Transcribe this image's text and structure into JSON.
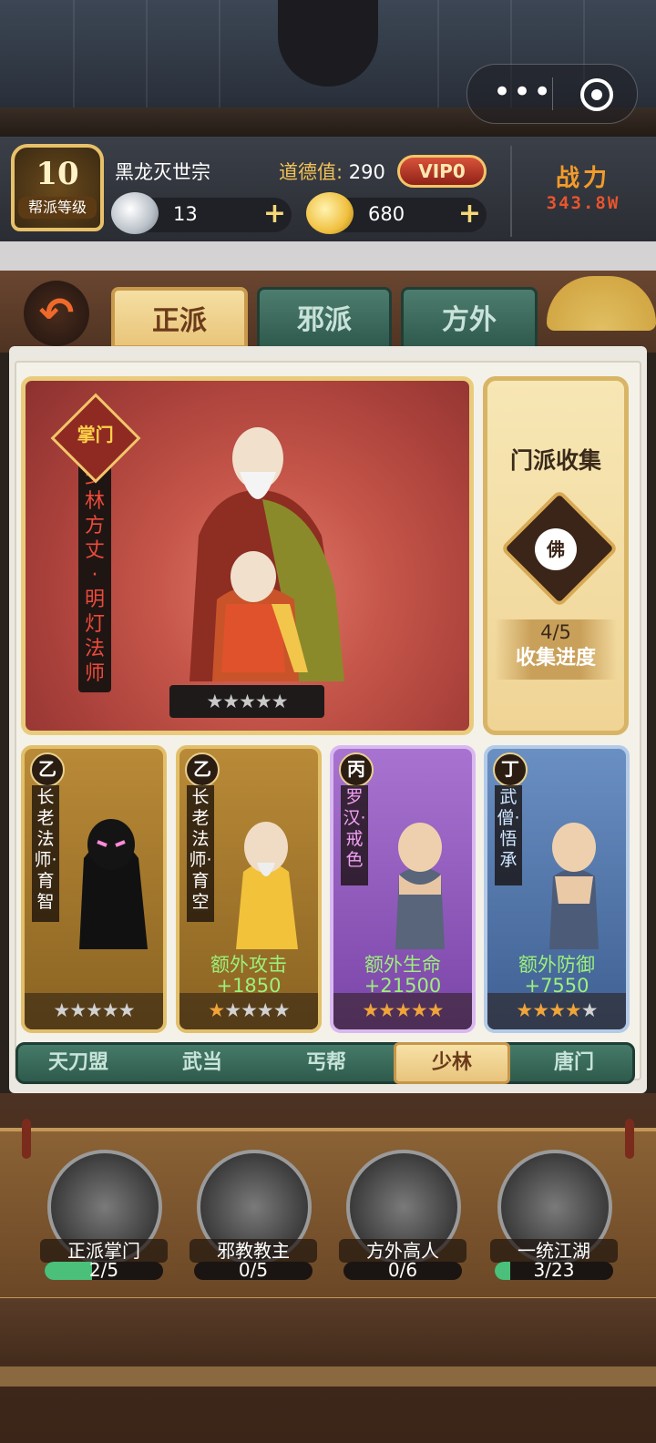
{
  "capsule": {
    "more_icon": "more-dots-icon",
    "close_icon": "target-circle-icon"
  },
  "player": {
    "sect_level": "10",
    "sect_level_label": "帮派等级",
    "name": "黑龙灭世宗",
    "morality_label": "道德值:",
    "morality_value": "290",
    "vip": "VIP0",
    "silver": "13",
    "gold": "680",
    "power_label": "战力",
    "power_value": "343.8W"
  },
  "tabs": [
    {
      "label": "正派",
      "active": true
    },
    {
      "label": "邪派",
      "active": false
    },
    {
      "label": "方外",
      "active": false
    }
  ],
  "hero": {
    "badge": "掌门",
    "name": "少林方丈·明灯法师",
    "stars": "★★★★★"
  },
  "collection": {
    "title": "门派收集",
    "emblem": "佛",
    "progress": "4/5",
    "progress_label": "收集进度"
  },
  "members": [
    {
      "grade": "乙",
      "name": "长老法师·育智",
      "bonus_label": "",
      "bonus_value": "",
      "stars_on": "",
      "stars_off": "★★★★★"
    },
    {
      "grade": "乙",
      "name": "长老法师·育空",
      "bonus_label": "额外攻击",
      "bonus_value": "+1850",
      "stars_on": "★",
      "stars_off": "★★★★"
    },
    {
      "grade": "丙",
      "name": "罗汉·戒色",
      "bonus_label": "额外生命",
      "bonus_value": "+21500",
      "stars_on": "★★★★★",
      "stars_off": ""
    },
    {
      "grade": "丁",
      "name": "武僧·悟承",
      "bonus_label": "额外防御",
      "bonus_value": "+7550",
      "stars_on": "★★★★",
      "stars_off": "★"
    }
  ],
  "factions": [
    {
      "label": "天刀盟",
      "active": false
    },
    {
      "label": "武当",
      "active": false
    },
    {
      "label": "丐帮",
      "active": false
    },
    {
      "label": "少林",
      "active": true
    },
    {
      "label": "唐门",
      "active": false
    }
  ],
  "achievements": [
    {
      "label": "正派掌门",
      "progress": "2/5",
      "fraction": 0.4
    },
    {
      "label": "邪教教主",
      "progress": "0/5",
      "fraction": 0
    },
    {
      "label": "方外高人",
      "progress": "0/6",
      "fraction": 0
    },
    {
      "label": "一统江湖",
      "progress": "3/23",
      "fraction": 0.13
    }
  ],
  "colors": {
    "accent_gold": "#e9cc7b",
    "power_red": "#e8552e",
    "bonus_green": "#9cf07a"
  }
}
